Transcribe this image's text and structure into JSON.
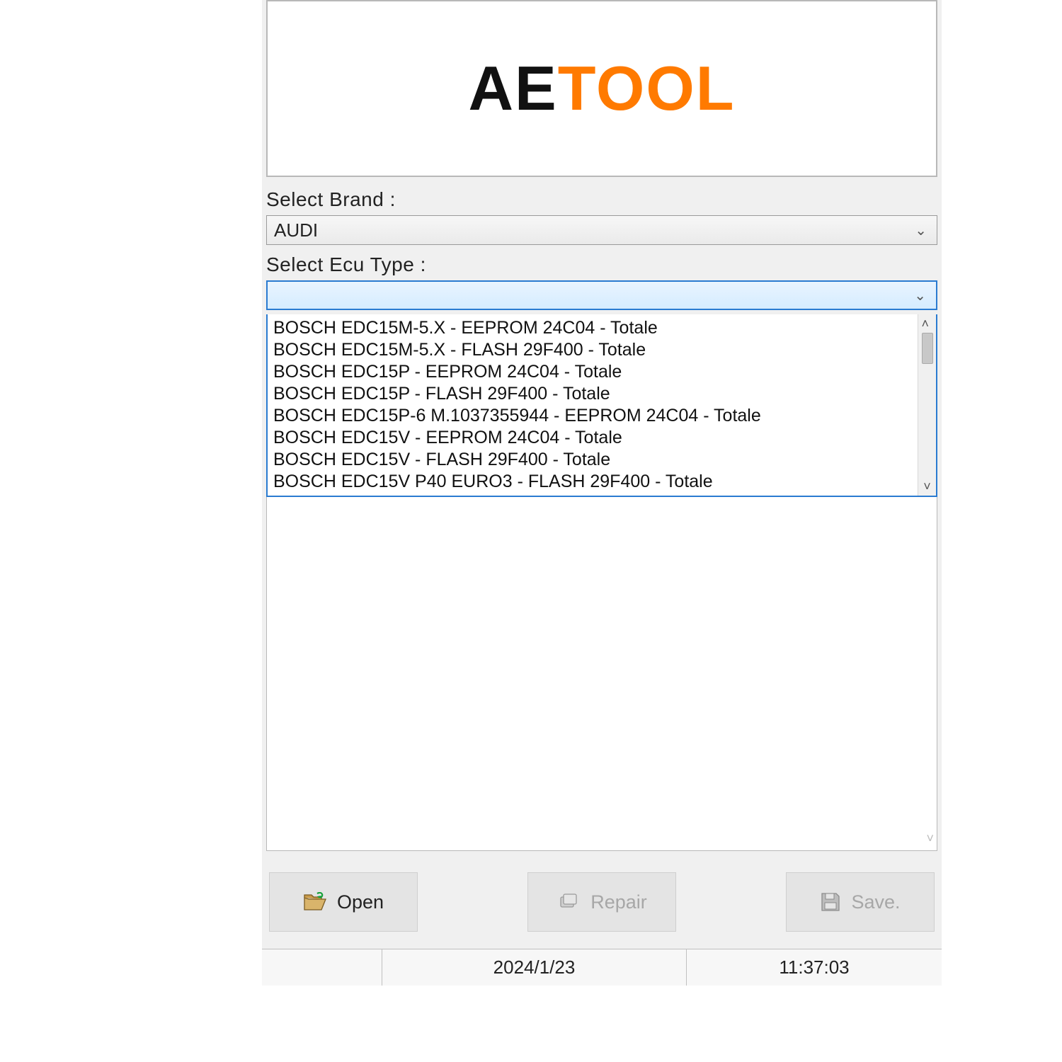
{
  "logo": {
    "part_a": "AE",
    "part_b": "TOOL"
  },
  "labels": {
    "brand": "Select Brand   :",
    "ecu": "Select Ecu Type   :"
  },
  "brand_select": {
    "value": "AUDI"
  },
  "ecu_select": {
    "value": ""
  },
  "ecu_options": [
    "BOSCH EDC15M-5.X - EEPROM 24C04 - Totale",
    "BOSCH EDC15M-5.X - FLASH 29F400 - Totale",
    "BOSCH EDC15P - EEPROM 24C04 - Totale",
    "BOSCH EDC15P - FLASH 29F400 - Totale",
    "BOSCH EDC15P-6 M.1037355944 - EEPROM 24C04 - Totale",
    "BOSCH EDC15V - EEPROM 24C04 - Totale",
    "BOSCH EDC15V - FLASH 29F400 - Totale",
    "BOSCH EDC15V P40 EURO3 - FLASH 29F400 - Totale"
  ],
  "buttons": {
    "open": "Open",
    "repair": "Repair",
    "save": "Save."
  },
  "status": {
    "date": "2024/1/23",
    "time": "11:37:03"
  }
}
